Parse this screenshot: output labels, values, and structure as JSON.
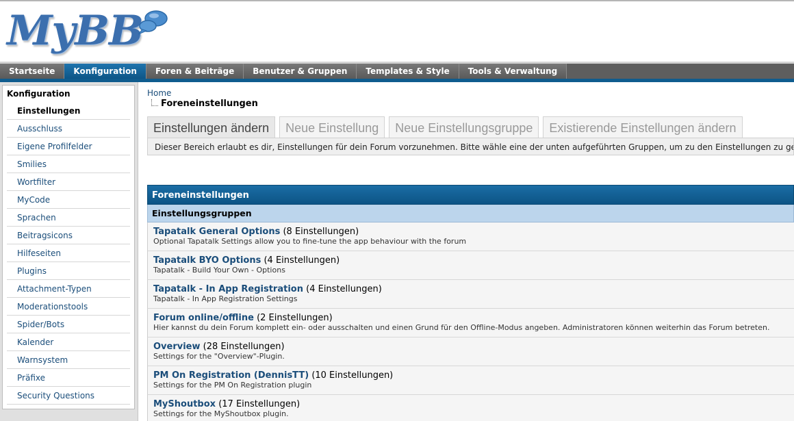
{
  "logo": {
    "text": "MyBB"
  },
  "nav": {
    "tabs": [
      {
        "label": "Startseite",
        "active": false
      },
      {
        "label": "Konfiguration",
        "active": true
      },
      {
        "label": "Foren & Beiträge",
        "active": false
      },
      {
        "label": "Benutzer & Gruppen",
        "active": false
      },
      {
        "label": "Templates & Style",
        "active": false
      },
      {
        "label": "Tools & Verwaltung",
        "active": false
      }
    ]
  },
  "sidebar": {
    "title": "Konfiguration",
    "items": [
      {
        "label": "Einstellungen",
        "active": true
      },
      {
        "label": "Ausschluss"
      },
      {
        "label": "Eigene Profilfelder"
      },
      {
        "label": "Smilies"
      },
      {
        "label": "Wortfilter"
      },
      {
        "label": "MyCode"
      },
      {
        "label": "Sprachen"
      },
      {
        "label": "Beitragsicons"
      },
      {
        "label": "Hilfeseiten"
      },
      {
        "label": "Plugins"
      },
      {
        "label": "Attachment-Typen"
      },
      {
        "label": "Moderationstools"
      },
      {
        "label": "Spider/Bots"
      },
      {
        "label": "Kalender"
      },
      {
        "label": "Warnsystem"
      },
      {
        "label": "Präfixe"
      },
      {
        "label": "Security Questions"
      }
    ]
  },
  "breadcrumb": {
    "home": "Home",
    "current": "Foreneinstellungen"
  },
  "tabs": [
    {
      "label": "Einstellungen ändern",
      "active": true
    },
    {
      "label": "Neue Einstellung"
    },
    {
      "label": "Neue Einstellungsgruppe"
    },
    {
      "label": "Existierende Einstellungen ändern"
    }
  ],
  "tab_description": "Dieser Bereich erlaubt es dir, Einstellungen für dein Forum vorzunehmen. Bitte wähle eine der unten aufgeführten Gruppen, um zu den Einstellungen zu gelangen.",
  "table": {
    "title": "Foreneinstellungen",
    "subhead": "Einstellungsgruppen",
    "rows": [
      {
        "name": "Tapatalk General Options",
        "count": "(8 Einstellungen)",
        "desc": "Optional Tapatalk Settings allow you to fine-tune the app behaviour with the forum"
      },
      {
        "name": "Tapatalk BYO Options",
        "count": "(4 Einstellungen)",
        "desc": "Tapatalk - Build Your Own - Options"
      },
      {
        "name": "Tapatalk - In App Registration",
        "count": "(4 Einstellungen)",
        "desc": "Tapatalk - In App Registration Settings"
      },
      {
        "name": "Forum online/offline",
        "count": "(2 Einstellungen)",
        "desc": "Hier kannst du dein Forum komplett ein- oder ausschalten und einen Grund für den Offline-Modus angeben. Administratoren können weiterhin das Forum betreten."
      },
      {
        "name": "Overview",
        "count": "(28 Einstellungen)",
        "desc": "Settings for the \"Overview\"-Plugin."
      },
      {
        "name": "PM On Registration (DennisTT)",
        "count": "(10 Einstellungen)",
        "desc": "Settings for the PM On Registration plugin"
      },
      {
        "name": "MyShoutbox",
        "count": "(17 Einstellungen)",
        "desc": "Settings for the MyShoutbox plugin."
      }
    ]
  }
}
